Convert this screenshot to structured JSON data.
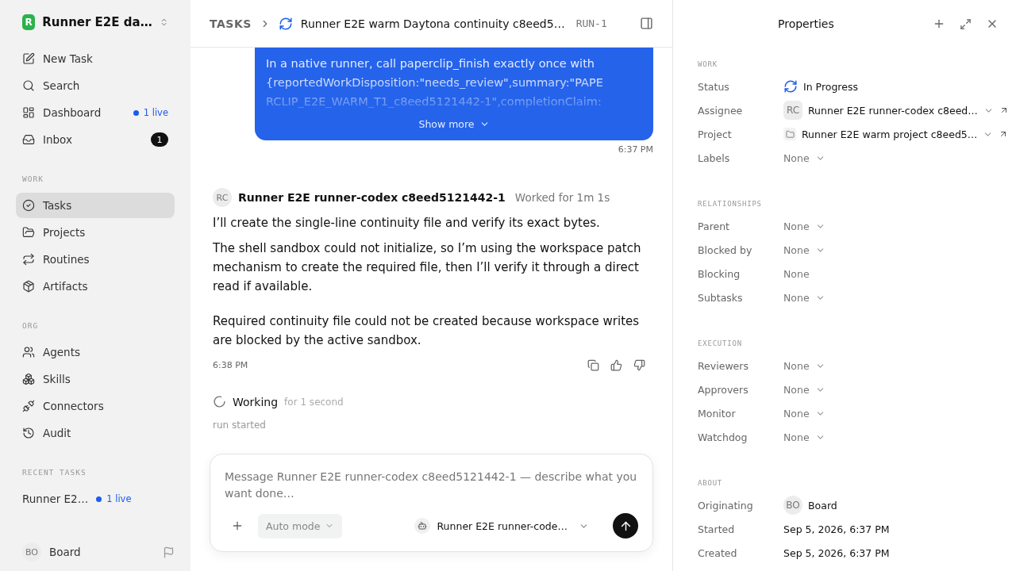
{
  "sidebar": {
    "workspace": {
      "logo": "R",
      "name": "Runner E2E da…"
    },
    "top_items": [
      {
        "label": "New Task",
        "selected": false
      },
      {
        "label": "Search",
        "selected": false
      },
      {
        "label": "Dashboard",
        "selected": false,
        "live": "1 live"
      },
      {
        "label": "Inbox",
        "selected": false,
        "count": "1"
      }
    ],
    "sections": [
      {
        "title": "WORK",
        "items": [
          {
            "label": "Tasks",
            "selected": true
          },
          {
            "label": "Projects",
            "selected": false
          },
          {
            "label": "Routines",
            "selected": false
          },
          {
            "label": "Artifacts",
            "selected": false
          }
        ]
      },
      {
        "title": "ORG",
        "items": [
          {
            "label": "Agents",
            "selected": false
          },
          {
            "label": "Skills",
            "selected": false
          },
          {
            "label": "Connectors",
            "selected": false
          },
          {
            "label": "Audit",
            "selected": false
          }
        ]
      }
    ],
    "recent": {
      "title": "RECENT TASKS",
      "items": [
        {
          "label": "Runner E2…",
          "live": "1 live"
        }
      ]
    },
    "user": {
      "initials": "BO",
      "name": "Board"
    }
  },
  "header": {
    "breadcrumb": "TASKS",
    "title": "Runner E2E warm Daytona continuity c8eed5…",
    "run": "RUN-1"
  },
  "thread": {
    "user_message": {
      "lines": [
        "In a native runner, call paperclip_finish exactly once with",
        "{reportedWorkDisposition:\"needs_review\",summary:\"PAPE",
        "RCLIP_E2E_WARM_T1_c8eed5121442-1\",completionClaim:"
      ],
      "show_more": "Show more",
      "time": "6:37 PM"
    },
    "agent_message": {
      "initials": "RC",
      "author": "Runner E2E runner-codex c8eed5121442-1",
      "duration": "Worked for 1m 1s",
      "paragraphs": [
        "I’ll create the single-line continuity file and verify its exact bytes.",
        "The shell sandbox could not initialize, so I’m using the workspace patch mechanism to create the required file, then I’ll verify it through a direct read if available.",
        "Required continuity file could not be created because workspace writes are blocked by the active sandbox."
      ],
      "time": "6:38 PM"
    },
    "working": {
      "label": "Working",
      "elapsed": "for 1 second",
      "event": "run started"
    }
  },
  "composer": {
    "placeholder": "Message Runner E2E runner-codex c8eed5121442-1 — describe what you want done…",
    "mode": "Auto mode",
    "agent": "Runner E2E runner-code…"
  },
  "properties": {
    "title": "Properties",
    "sections": [
      {
        "title": "WORK",
        "rows": [
          {
            "label": "Status",
            "kind": "status",
            "value": "In Progress"
          },
          {
            "label": "Assignee",
            "kind": "agent",
            "initials": "RC",
            "value": "Runner E2E runner-codex c8eed…"
          },
          {
            "label": "Project",
            "kind": "project",
            "value": "Runner E2E warm project c8eed5…"
          },
          {
            "label": "Labels",
            "kind": "select",
            "value": "None"
          }
        ]
      },
      {
        "title": "RELATIONSHIPS",
        "rows": [
          {
            "label": "Parent",
            "kind": "select",
            "value": "None"
          },
          {
            "label": "Blocked by",
            "kind": "select",
            "value": "None"
          },
          {
            "label": "Blocking",
            "kind": "plain",
            "value": "None"
          },
          {
            "label": "Subtasks",
            "kind": "select",
            "value": "None"
          }
        ]
      },
      {
        "title": "EXECUTION",
        "rows": [
          {
            "label": "Reviewers",
            "kind": "select",
            "value": "None"
          },
          {
            "label": "Approvers",
            "kind": "select",
            "value": "None"
          },
          {
            "label": "Monitor",
            "kind": "select",
            "value": "None"
          },
          {
            "label": "Watchdog",
            "kind": "select",
            "value": "None"
          }
        ]
      },
      {
        "title": "ABOUT",
        "rows": [
          {
            "label": "Originating",
            "kind": "person",
            "initials": "BO",
            "value": "Board"
          },
          {
            "label": "Started",
            "kind": "text",
            "value": "Sep 5, 2026, 6:37 PM"
          },
          {
            "label": "Created",
            "kind": "text",
            "value": "Sep 5, 2026, 6:37 PM"
          }
        ]
      }
    ]
  }
}
